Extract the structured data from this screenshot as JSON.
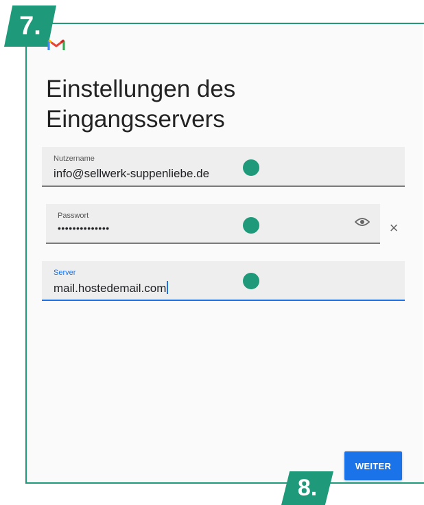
{
  "step_badges": {
    "top": "7.",
    "bottom": "8."
  },
  "app": {
    "logo": "gmail-logo"
  },
  "page": {
    "title_line1": "Einstellungen des",
    "title_line2": "Eingangsservers"
  },
  "form": {
    "username": {
      "label": "Nutzername",
      "value": "info@sellwerk-suppenliebe.de"
    },
    "password": {
      "label": "Passwort",
      "value": "••••••••••••••"
    },
    "server": {
      "label": "Server",
      "value": "mail.hostedemail.com"
    }
  },
  "actions": {
    "next_label": "WEITER"
  },
  "colors": {
    "accent": "#1e9a7a",
    "primary": "#1a73e8"
  }
}
